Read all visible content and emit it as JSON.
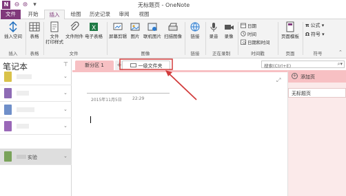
{
  "window": {
    "title": "无标题页 - OneNote",
    "app_icon": "N"
  },
  "ribbon_tabs": [
    {
      "label": "文件"
    },
    {
      "label": "开始"
    },
    {
      "label": "插入"
    },
    {
      "label": "绘图"
    },
    {
      "label": "历史记录"
    },
    {
      "label": "审阅"
    },
    {
      "label": "视图"
    }
  ],
  "ribbon": {
    "insert_space": "插入空间",
    "table": "表格",
    "file_printout": "文件\n打印样式",
    "file_attachment": "文件附件",
    "spreadsheet": "电子表格",
    "screen_clipping": "屏幕剪辑",
    "picture": "图片",
    "online_picture": "联机图片",
    "scanned_image": "扫描图像",
    "link": "链接",
    "record_audio": "录音",
    "record_video": "录像",
    "date": "日期",
    "time": "时间",
    "date_time": "日期和时间",
    "page_templates": "页面模板",
    "equation": "公式",
    "symbol": "符号",
    "groups": {
      "insert": "插入",
      "tables": "表格",
      "files": "文件",
      "images": "图像",
      "links": "链接",
      "recording": "正在录制",
      "timestamp": "时间戳",
      "pages": "页面",
      "symbols": "符号"
    }
  },
  "notebooks": {
    "title": "笔记本",
    "items": [
      {
        "color": "#d9c24a",
        "name": ""
      },
      {
        "color": "#8e6bb5",
        "name": ""
      },
      {
        "color": "#6f8fc9",
        "name": ""
      },
      {
        "color": "#9a68b8",
        "name": ""
      },
      {
        "color": "#7aa35a",
        "name": "实验"
      }
    ]
  },
  "sections": {
    "active": "新分区 1",
    "add": "+",
    "folder": "一级文件夹"
  },
  "page": {
    "date": "2015年11月5日",
    "time": "22:29"
  },
  "search": {
    "placeholder": "搜索(Ctrl+E)"
  },
  "pages_pane": {
    "add_page": "添加页",
    "entries": [
      {
        "label": "无标题页"
      }
    ]
  },
  "colors": {
    "onenote_purple": "#80397b",
    "section_pink": "#f7c0c3",
    "annotation_red": "#d23c3c"
  }
}
